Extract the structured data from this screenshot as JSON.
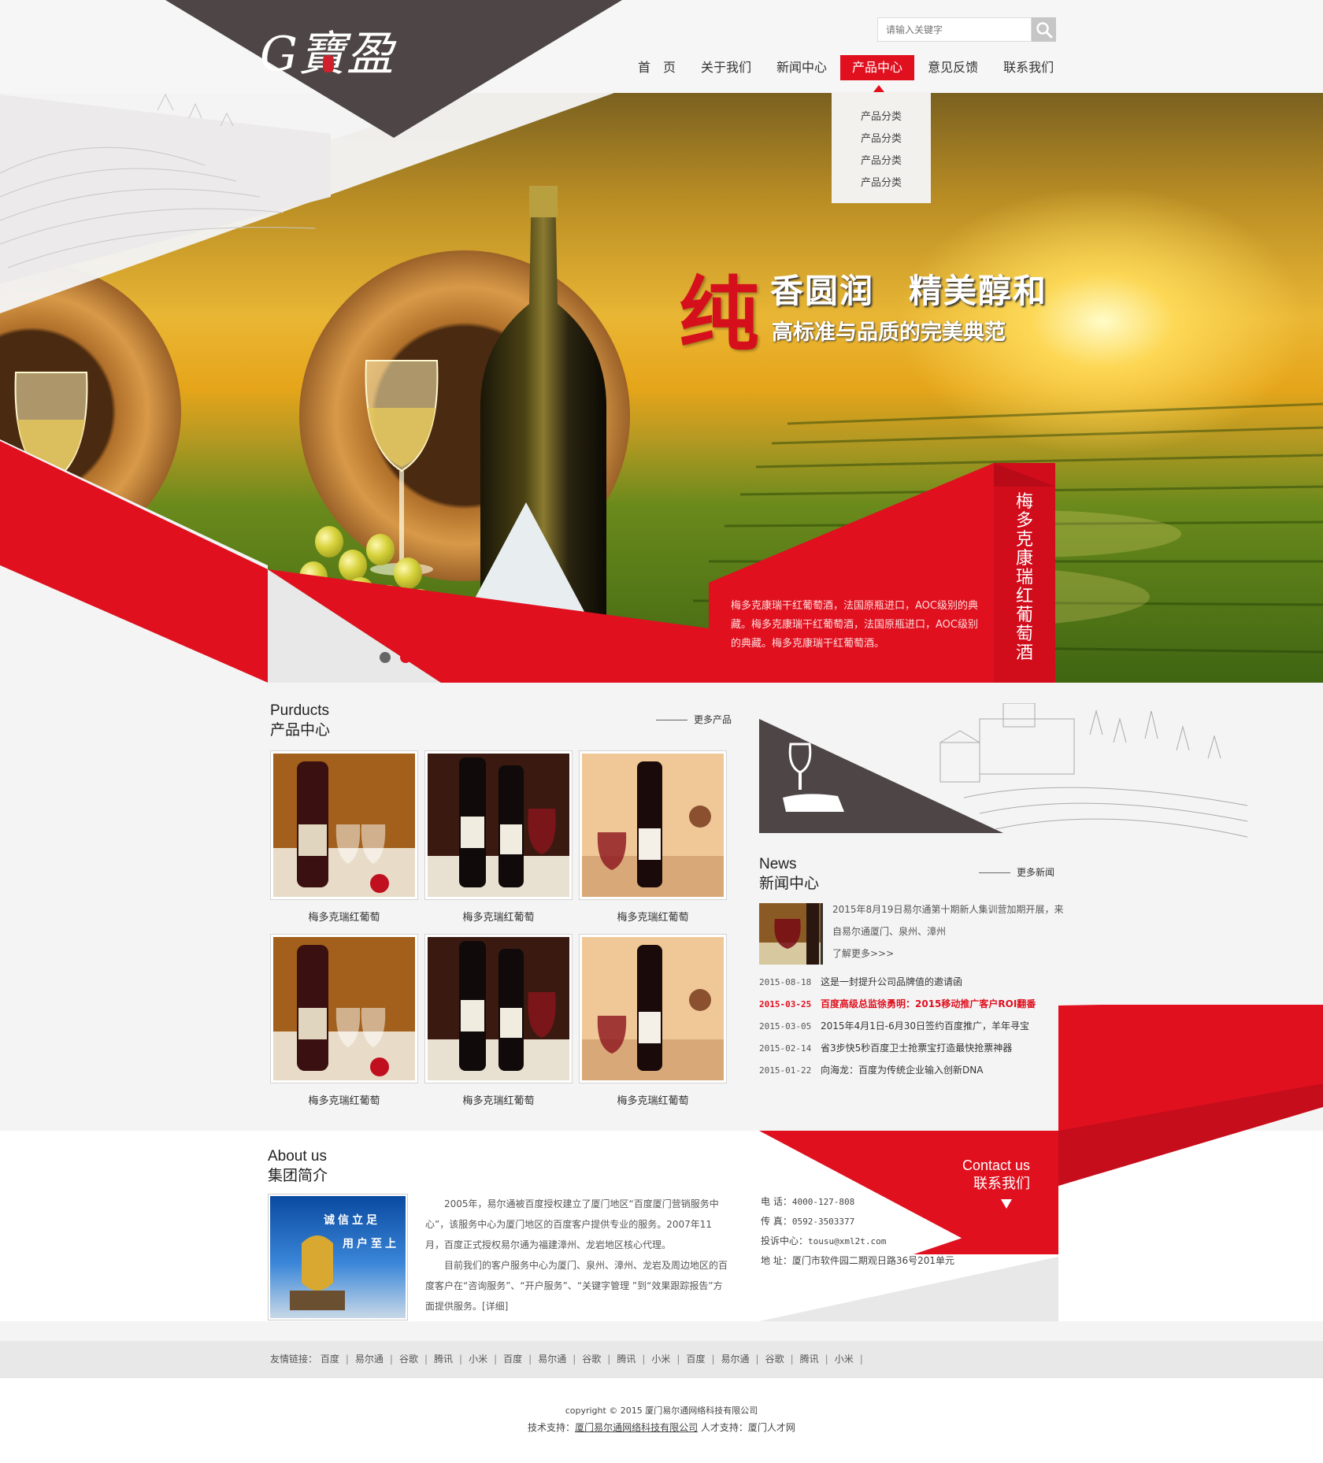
{
  "header": {
    "logo_text": "G寶盈",
    "search": {
      "placeholder": "请输入关键字"
    },
    "nav": [
      {
        "label": "首　页"
      },
      {
        "label": "关于我们"
      },
      {
        "label": "新闻中心"
      },
      {
        "label": "产品中心",
        "active": true
      },
      {
        "label": "意见反馈"
      },
      {
        "label": "联系我们"
      }
    ],
    "dropdown": [
      "产品分类",
      "产品分类",
      "产品分类",
      "产品分类"
    ]
  },
  "banner": {
    "headline_big": "纯",
    "headline_line1": "香圆润　精美醇和",
    "headline_line2": "高标准与品质的完美典范",
    "vertical_title": "梅多克康瑞红葡萄酒",
    "description": "梅多克康瑞干红葡萄酒，法国原瓶进口，AOC级别的典藏。梅多克康瑞干红葡萄酒，法国原瓶进口，AOC级别的典藏。梅多克康瑞干红葡萄酒。",
    "slides": 2,
    "active_slide": 2
  },
  "products": {
    "title_en": "Purducts",
    "title_cn": "产品中心",
    "more": "更多产品",
    "items": [
      {
        "name": "梅多克瑞红葡萄"
      },
      {
        "name": "梅多克瑞红葡萄"
      },
      {
        "name": "梅多克瑞红葡萄"
      },
      {
        "name": "梅多克瑞红葡萄"
      },
      {
        "name": "梅多克瑞红葡萄"
      },
      {
        "name": "梅多克瑞红葡萄"
      }
    ]
  },
  "news": {
    "title_en": "News",
    "title_cn": "新闻中心",
    "more": "更多新闻",
    "feature_text": "2015年8月19日易尔通第十期新人集训营加期开展，来自易尔通厦门、泉州、漳州",
    "feature_more": "了解更多>>>",
    "items": [
      {
        "date": "2015-08-18",
        "title": "这是一封提升公司品牌值的邀请函",
        "hot": false
      },
      {
        "date": "2015-03-25",
        "title": "百度高级总监徐勇明：2015移动推广客户ROI翻番",
        "hot": true
      },
      {
        "date": "2015-03-05",
        "title": "2015年4月1日-6月30日签约百度推广，羊年寻宝",
        "hot": false
      },
      {
        "date": "2015-02-14",
        "title": "省3步快5秒百度卫士抢票宝打造最快抢票神器",
        "hot": false
      },
      {
        "date": "2015-01-22",
        "title": "向海龙：百度为传统企业输入创新DNA",
        "hot": false
      }
    ]
  },
  "about": {
    "title_en": "About us",
    "title_cn": "集团简介",
    "slogan1": "诚信立足",
    "slogan2": "用户至上",
    "para1": "2005年，易尔通被百度授权建立了厦门地区“百度厦门营销服务中心”，该服务中心为厦门地区的百度客户提供专业的服务。2007年11月，百度正式授权易尔通为福建漳州、龙岩地区核心代理。",
    "para2": "目前我们的客户服务中心为厦门、泉州、漳州、龙岩及周边地区的百度客户在“咨询服务”、“开户服务”、“关键字管理 ”到“效果跟踪报告”方面提供服务。[详细]"
  },
  "contact": {
    "title_en": "Contact us",
    "title_cn": "联系我们",
    "rows": [
      {
        "label": "电  话：",
        "value": "4000-127-808"
      },
      {
        "label": "传  真：",
        "value": "0592-3503377"
      },
      {
        "label": "投诉中心：",
        "value": "tousu@xml2t.com"
      },
      {
        "label": "地  址：",
        "value": "厦门市软件园二期观日路36号201单元"
      }
    ]
  },
  "links": {
    "label": "友情链接：",
    "items": [
      "百度",
      "易尔通",
      "谷歌",
      "腾讯",
      "小米",
      "百度",
      "易尔通",
      "谷歌",
      "腾讯",
      "小米",
      "百度",
      "易尔通",
      "谷歌",
      "腾讯",
      "小米"
    ]
  },
  "footer": {
    "copyright": "copyright © 2015 厦门易尔通网络科技有限公司",
    "tech_label": "技术支持：",
    "tech_company": "厦门易尔通网络科技有限公司",
    "talent_label": "人才支持：",
    "talent": "厦门人才网"
  },
  "colors": {
    "accent": "#e0101f",
    "dark": "#4e4646"
  }
}
